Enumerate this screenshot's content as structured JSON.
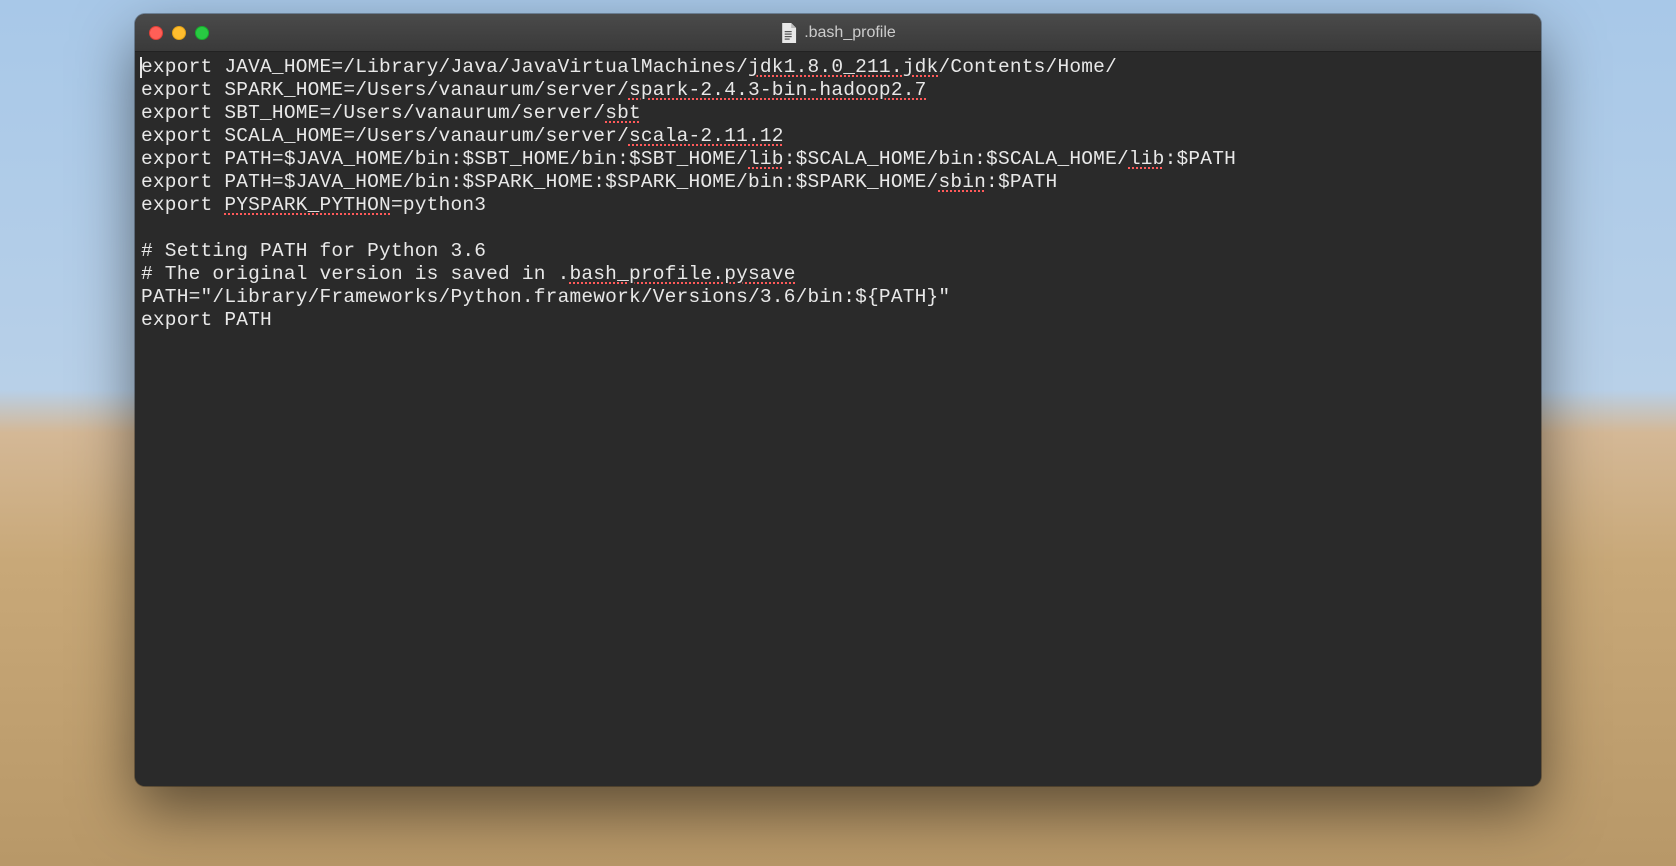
{
  "window": {
    "title": ".bash_profile"
  },
  "file_lines": [
    {
      "segments": [
        {
          "t": "export JAVA_HOME=/Library/Java/JavaVirtualMachines/"
        },
        {
          "t": "jdk1.8.0_211.jdk",
          "spell": true
        },
        {
          "t": "/Contents/Home/"
        }
      ],
      "cursor_at_start": true
    },
    {
      "segments": [
        {
          "t": "export SPARK_HOME=/Users/vanaurum/server/"
        },
        {
          "t": "spark-2.4.3-bin-hadoop2.7",
          "spell": true
        }
      ]
    },
    {
      "segments": [
        {
          "t": "export SBT_HOME=/Users/vanaurum/server/"
        },
        {
          "t": "sbt",
          "spell": true
        }
      ]
    },
    {
      "segments": [
        {
          "t": "export SCALA_HOME=/Users/vanaurum/server/"
        },
        {
          "t": "scala-2.11.12",
          "spell": true
        }
      ]
    },
    {
      "segments": [
        {
          "t": "export PATH=$JAVA_HOME/bin:$SBT_HOME/bin:$SBT_HOME/"
        },
        {
          "t": "lib",
          "spell": true
        },
        {
          "t": ":$SCALA_HOME/bin:$SCALA_HOME/"
        },
        {
          "t": "lib",
          "spell": true
        },
        {
          "t": ":$PATH"
        }
      ]
    },
    {
      "segments": [
        {
          "t": "export PATH=$JAVA_HOME/bin:$SPARK_HOME:$SPARK_HOME/bin:$SPARK_HOME/"
        },
        {
          "t": "sbin",
          "spell": true
        },
        {
          "t": ":$PATH"
        }
      ]
    },
    {
      "segments": [
        {
          "t": "export "
        },
        {
          "t": "PYSPARK_PYTHON",
          "spell": true
        },
        {
          "t": "=python3"
        }
      ]
    },
    {
      "segments": [
        {
          "t": ""
        }
      ]
    },
    {
      "segments": [
        {
          "t": "# Setting PATH for Python 3.6"
        }
      ]
    },
    {
      "segments": [
        {
          "t": "# The original version is saved in ."
        },
        {
          "t": "bash_profile.pysave",
          "spell": true
        }
      ]
    },
    {
      "segments": [
        {
          "t": "PATH=\"/Library/Frameworks/Python.framework/Versions/3.6/bin:${PATH}\""
        }
      ]
    },
    {
      "segments": [
        {
          "t": "export PATH"
        }
      ]
    }
  ]
}
